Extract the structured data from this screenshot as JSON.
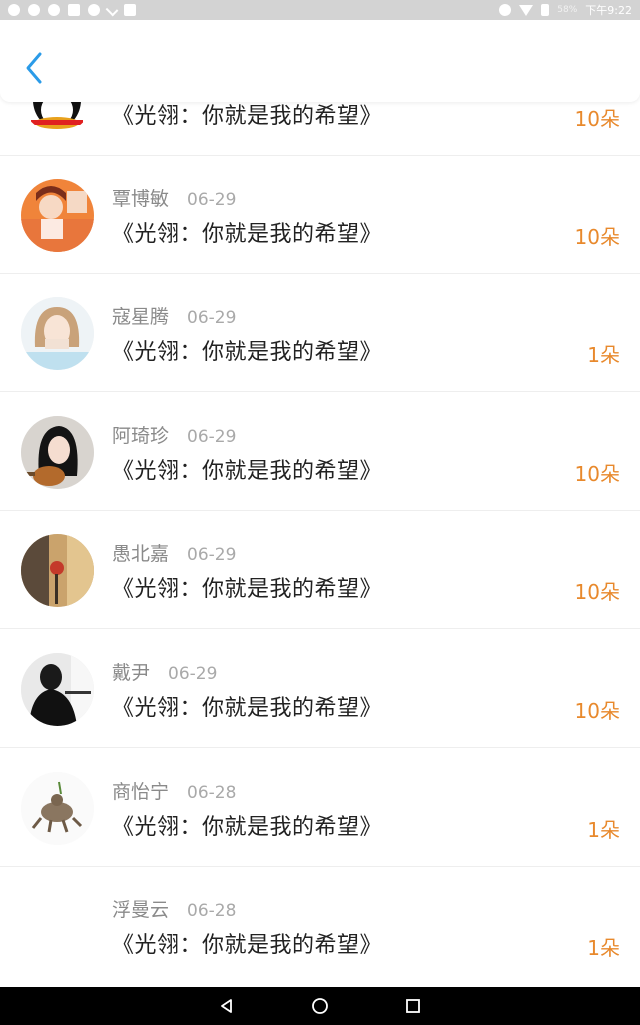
{
  "status_bar": {
    "battery": "58%",
    "time": "下午9:22"
  },
  "header": {
    "back_icon": "chevron-left-icon",
    "accent": "#2b9be8"
  },
  "rows": [
    {
      "name": "",
      "date": "",
      "title": "《光翎：你就是我的希望》",
      "count": "10朵",
      "avatar": "penguin-avatar"
    },
    {
      "name": "覃博敏",
      "date": "06-29",
      "title": "《光翎：你就是我的希望》",
      "count": "10朵",
      "avatar": "avatar-orange"
    },
    {
      "name": "寇星腾",
      "date": "06-29",
      "title": "《光翎：你就是我的希望》",
      "count": "1朵",
      "avatar": "avatar-girl-light"
    },
    {
      "name": "阿琦珍",
      "date": "06-29",
      "title": "《光翎：你就是我的希望》",
      "count": "10朵",
      "avatar": "avatar-girl-guitar"
    },
    {
      "name": "愚北嘉",
      "date": "06-29",
      "title": "《光翎：你就是我的希望》",
      "count": "10朵",
      "avatar": "avatar-street"
    },
    {
      "name": "戴尹",
      "date": "06-29",
      "title": "《光翎：你就是我的希望》",
      "count": "10朵",
      "avatar": "avatar-dark"
    },
    {
      "name": "商怡宁",
      "date": "06-28",
      "title": "《光翎：你就是我的希望》",
      "count": "1朵",
      "avatar": "avatar-cat"
    },
    {
      "name": "浮曼云",
      "date": "06-28",
      "title": "《光翎：你就是我的希望》",
      "count": "1朵",
      "avatar": "avatar-blank"
    }
  ],
  "colors": {
    "count": "#e8892c",
    "name": "#8a8a8a",
    "date": "#a9a9a9"
  }
}
